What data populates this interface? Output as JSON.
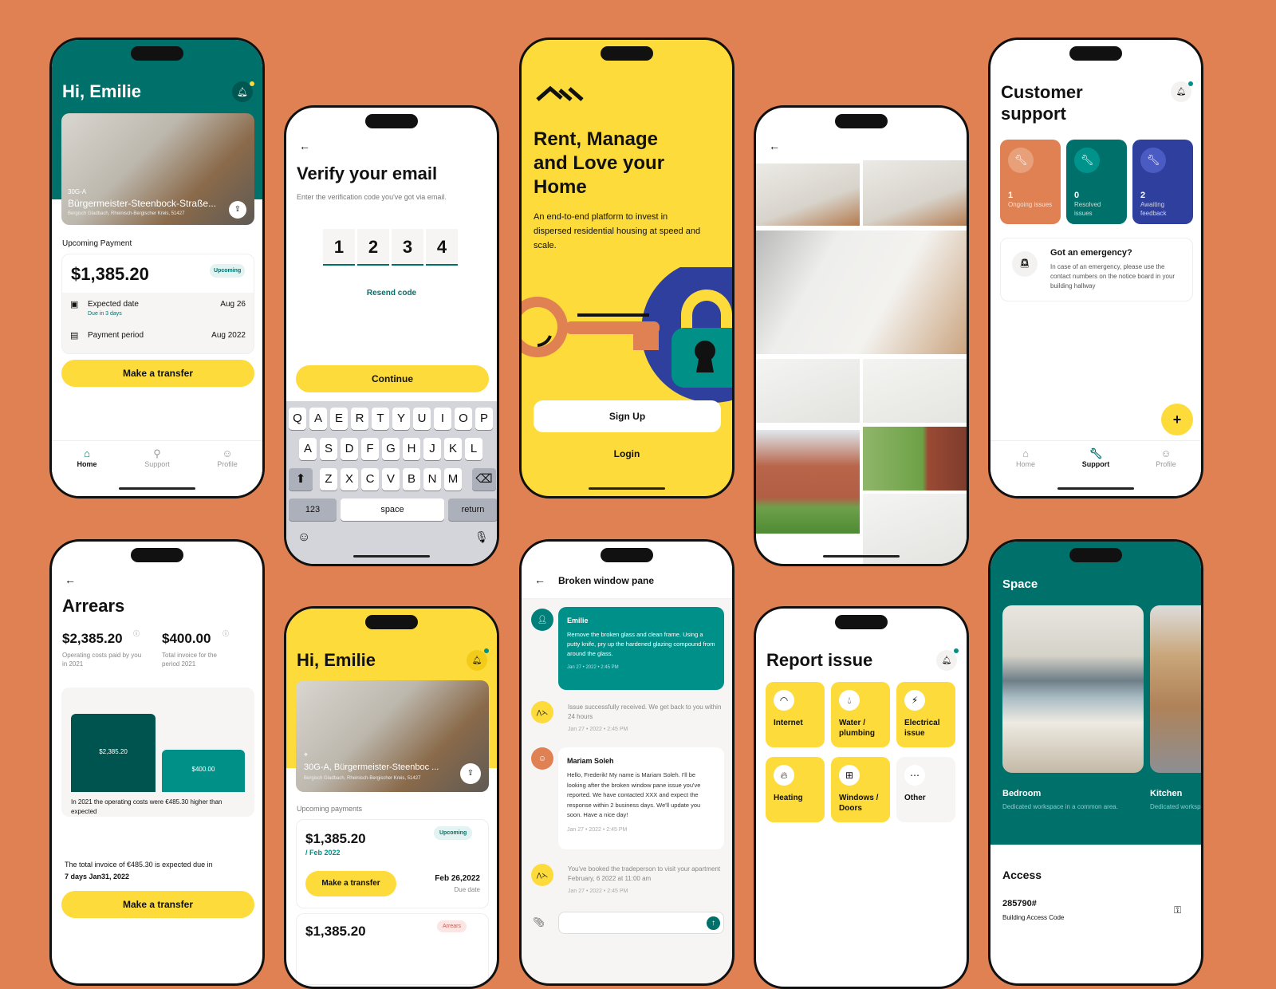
{
  "phone1": {
    "greeting": "Hi, Emilie",
    "unit": "30G-A",
    "street": "Bürgermeister-Steenbock-Straße...",
    "city": "Bergisch Gladbach, Rheinisch-Bergischer Kreis, 51427",
    "section_title": "Upcoming Payment",
    "amount": "$1,385.20",
    "badge": "Upcoming",
    "rows": [
      {
        "label": "Expected date",
        "sub": "Due in 3 days",
        "value": "Aug 26"
      },
      {
        "label": "Payment period",
        "value": "Aug 2022"
      }
    ],
    "cta": "Make a transfer",
    "nav": [
      "Home",
      "Support",
      "Profile"
    ]
  },
  "phone2": {
    "title": "Verify your email",
    "subtitle": "Enter the verification code you've got via email.",
    "code": [
      "1",
      "2",
      "3",
      "4"
    ],
    "resend": "Resend code",
    "cta": "Continue",
    "keyboard": {
      "row1": [
        "Q",
        "A",
        "E",
        "R",
        "T",
        "Y",
        "U",
        "I",
        "O",
        "P"
      ],
      "row2": [
        "A",
        "S",
        "D",
        "F",
        "G",
        "H",
        "J",
        "K",
        "L"
      ],
      "row3": [
        "Z",
        "X",
        "C",
        "V",
        "B",
        "N",
        "M"
      ],
      "numbers": "123",
      "space": "space",
      "return": "return"
    }
  },
  "phone3": {
    "headline": "Rent, Manage and Love your Home",
    "body": "An end-to-end platform to invest in dispersed residential housing at speed and scale.",
    "signup": "Sign Up",
    "login": "Login"
  },
  "phone5": {
    "title": "Customer support",
    "stats": [
      {
        "num": "1",
        "label": "Ongoing issues",
        "color": "#DF8152"
      },
      {
        "num": "0",
        "label": "Resolved issues",
        "color": "#00706B"
      },
      {
        "num": "2",
        "label": "Awaiting feedback",
        "color": "#2F3F9E"
      }
    ],
    "emergency_title": "Got an emergency?",
    "emergency_body": "In case of an emergency, please use the contact numbers on the notice board in your building hallway",
    "fab": "+",
    "nav": [
      "Home",
      "Support",
      "Profile"
    ]
  },
  "phone6": {
    "title": "Arrears",
    "stat1_value": "$2,385.20",
    "stat1_label": "Operating costs paid by you in 2021",
    "stat2_value": "$400.00",
    "stat2_label": "Total invoice for the period 2021",
    "bar1": "$2,385.20",
    "bar2": "$400.00",
    "note": "In 2021 the operating costs were €485.30 higher than expected",
    "invoice_text": "The total invoice of €485.30 is expected due in",
    "invoice_due": "7 days Jan31, 2022",
    "cta": "Make a transfer"
  },
  "phone7": {
    "greeting": "Hi, Emilie",
    "address": "30G-A, Bürgermeister-Steenboc ...",
    "city": "Bergisch Gladbach, Rheinisch-Bergischer Kreis, 51427",
    "section_title": "Upcoming payments",
    "amount": "$1,385.20",
    "period": "/ Feb 2022",
    "badge": "Upcoming",
    "cta": "Make a transfer",
    "due_date": "Feb 26,2022",
    "due_label": "Due date",
    "amount2": "$1,385.20",
    "badge2": "Arrears"
  },
  "phone8": {
    "title": "Broken window pane",
    "messages": [
      {
        "author": "Emilie",
        "text": "Remove the broken glass and clean frame. Using a putty knife, pry up the hardened glazing compound from around the glass.",
        "time": "Jan 27 • 2022 • 2:45 PM"
      },
      {
        "text": "Issue successfully received. We get back to you within 24 hours",
        "time": "Jan 27 • 2022 • 2:45 PM"
      },
      {
        "author": "Mariam Soleh",
        "text": "Hello, Frederik! My name is Mariam Soleh. I'll be looking after the broken window pane issue you've reported. We have contacted XXX and expect the response within 2 business days. We'll update you soon. Have a nice day!",
        "time": "Jan 27 • 2022 • 2:45 PM"
      },
      {
        "text": "You've booked the tradeperson to visit your apartment February, 6 2022 at 11:00 am",
        "time": "Jan 27 • 2022 • 2:45 PM"
      }
    ]
  },
  "phone9": {
    "title": "Report issue",
    "tiles": [
      "Internet",
      "Water / plumbing",
      "Electrical issue",
      "Heating",
      "Windows / Doors",
      "Other"
    ]
  },
  "phone10": {
    "title": "Space",
    "rooms": [
      {
        "name": "Bedroom",
        "desc": "Dedicated workspace in a common area."
      },
      {
        "name": "Kitchen",
        "desc": "Dedicated workspace in a common area."
      }
    ],
    "access_title": "Access",
    "code": "285790#",
    "code_label": "Building Access Code"
  }
}
